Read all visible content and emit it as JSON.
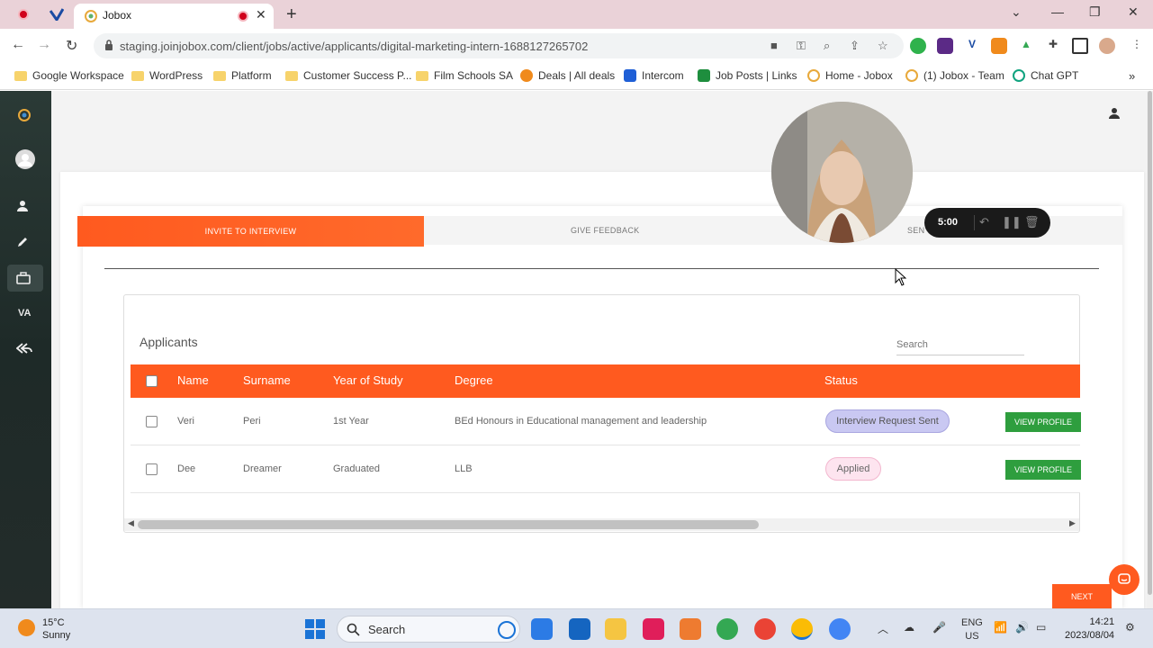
{
  "browser": {
    "tab_title": "Jobox",
    "url": "staging.joinjobox.com/client/jobs/active/applicants/digital-marketing-intern-1688127265702",
    "bookmarks": [
      {
        "label": "Google Workspace",
        "icon": "folder-icon"
      },
      {
        "label": "WordPress",
        "icon": "folder-icon"
      },
      {
        "label": "Platform",
        "icon": "folder-icon"
      },
      {
        "label": "Customer Success P...",
        "icon": "folder-icon"
      },
      {
        "label": "Film Schools SA",
        "icon": "folder-icon"
      },
      {
        "label": "Deals | All deals",
        "icon": "hubspot-icon"
      },
      {
        "label": "Intercom",
        "icon": "intercom-icon"
      },
      {
        "label": "Job Posts | Links",
        "icon": "sheets-icon"
      },
      {
        "label": "Home - Jobox",
        "icon": "jobox-icon"
      },
      {
        "label": "(1) Jobox - Team",
        "icon": "jobox-icon"
      },
      {
        "label": "Chat GPT",
        "icon": "openai-icon"
      }
    ]
  },
  "sidebar": {
    "items": [
      {
        "icon": "logo-icon"
      },
      {
        "icon": "avatar-icon"
      },
      {
        "icon": "user-icon"
      },
      {
        "icon": "pencil-icon"
      },
      {
        "icon": "briefcase-icon",
        "active": true
      },
      {
        "label": "VA"
      },
      {
        "icon": "reply-all-icon"
      }
    ]
  },
  "steps": {
    "invite": "INVITE TO INTERVIEW",
    "feedback": "GIVE FEEDBACK",
    "send": "SEN"
  },
  "applicants": {
    "title": "Applicants",
    "search_placeholder": "Search",
    "columns": [
      "Name",
      "Surname",
      "Year of Study",
      "Degree",
      "Status"
    ],
    "rows": [
      {
        "name": "Veri",
        "surname": "Peri",
        "year": "1st Year",
        "degree": "BEd Honours in Educational management and leadership",
        "status": "Interview Request Sent",
        "action": "VIEW PROFILE"
      },
      {
        "name": "Dee",
        "surname": "Dreamer",
        "year": "Graduated",
        "degree": "LLB",
        "status": "Applied",
        "action": "VIEW PROFILE"
      }
    ]
  },
  "next_label": "NEXT",
  "recorder": {
    "time": "5:00"
  },
  "taskbar": {
    "temp": "15°C",
    "weather": "Sunny",
    "search_label": "Search",
    "lang1": "ENG",
    "lang2": "US",
    "time": "14:21",
    "date": "2023/08/04"
  },
  "colors": {
    "accent": "#ff5a1f",
    "success": "#2e9e3e"
  }
}
